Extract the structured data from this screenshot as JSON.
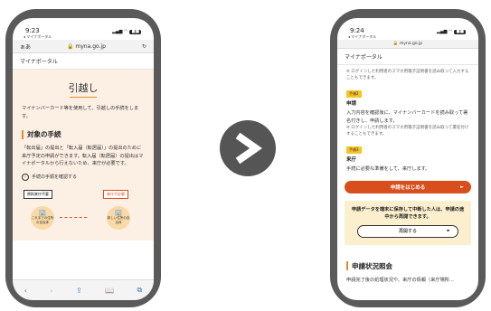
{
  "left_phone": {
    "time": "9:23",
    "back_label": "◂ マイナポータル",
    "aa": "ぁあ",
    "url": "myna.go.jp",
    "site_name": "マイナポータル",
    "page_title": "引越し",
    "intro": "マイナンバーカード等を使用して、引越しの手続をします。",
    "section_title": "対象の手続",
    "section_body": "「転出届」の提出と「転入届（転居届）」の提出のために来庁予定の申請ができます。転入届（転居届）の提出はマイナポータルから行えないため、来庁が必要です。",
    "link_text": "手続の手順を確認する",
    "tag_left": "原則来庁不要",
    "tag_right": "来庁が必要",
    "bubble_left": "これまでの住所の自治体",
    "bubble_right": "新しい住所の自治体"
  },
  "right_phone": {
    "time": "9:24",
    "back_label": "◂ マイナポータル",
    "url": "myna.go.jp",
    "site_name": "マイナポータル",
    "note_top": "※ ログインした利用者のスマホ用電子証明書を読み取って入力することもできます。",
    "step2_label": "手順2",
    "step2_title": "申請",
    "step2_body": "入力内容を確認後に、マイナンバーカードを読み取って署名付きし、申請します。",
    "step2_note": "※ ログインした利用者のスマホ用電子証明書を読み取って署名付けすることもできます。",
    "step3_label": "手順3",
    "step3_title": "来庁",
    "step3_body": "手続に必要な準備をして、来庁します。",
    "cta_label": "申請をはじめる",
    "notice": "申請データを端末に保存して中断した人は、申請の途中から再開できます。",
    "resume_label": "再開する",
    "section_title": "申請状況照会",
    "section_body": "申請完了後の処理状況や、来庁の情報（来庁場所..."
  }
}
